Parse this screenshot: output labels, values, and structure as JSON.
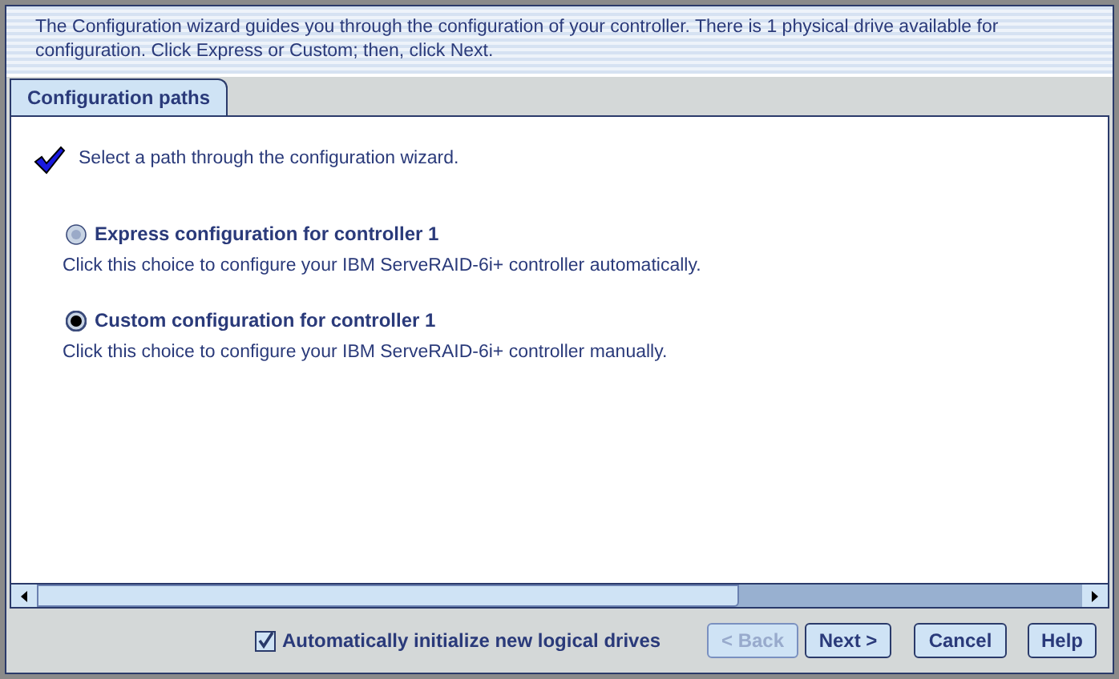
{
  "intro": "The Configuration wizard guides you through the configuration of your controller. There is 1 physical drive available for configuration. Click Express or Custom; then, click Next.",
  "tabs": [
    {
      "label": "Configuration paths",
      "selected": true
    }
  ],
  "instruction": "Select a path through the configuration wizard.",
  "options": [
    {
      "label": "Express configuration for controller 1",
      "description": "Click this choice to configure your IBM ServeRAID-6i+ controller automatically.",
      "selected": false
    },
    {
      "label": "Custom configuration for controller 1",
      "description": "Click this choice to configure your IBM ServeRAID-6i+ controller manually.",
      "selected": true
    }
  ],
  "auto_initialize": {
    "label": "Automatically initialize new logical drives",
    "checked": true
  },
  "buttons": [
    {
      "label": "< Back",
      "disabled": true
    },
    {
      "label": "Next >",
      "disabled": false
    },
    {
      "label": "Cancel",
      "disabled": false
    },
    {
      "label": "Help",
      "disabled": false
    }
  ]
}
